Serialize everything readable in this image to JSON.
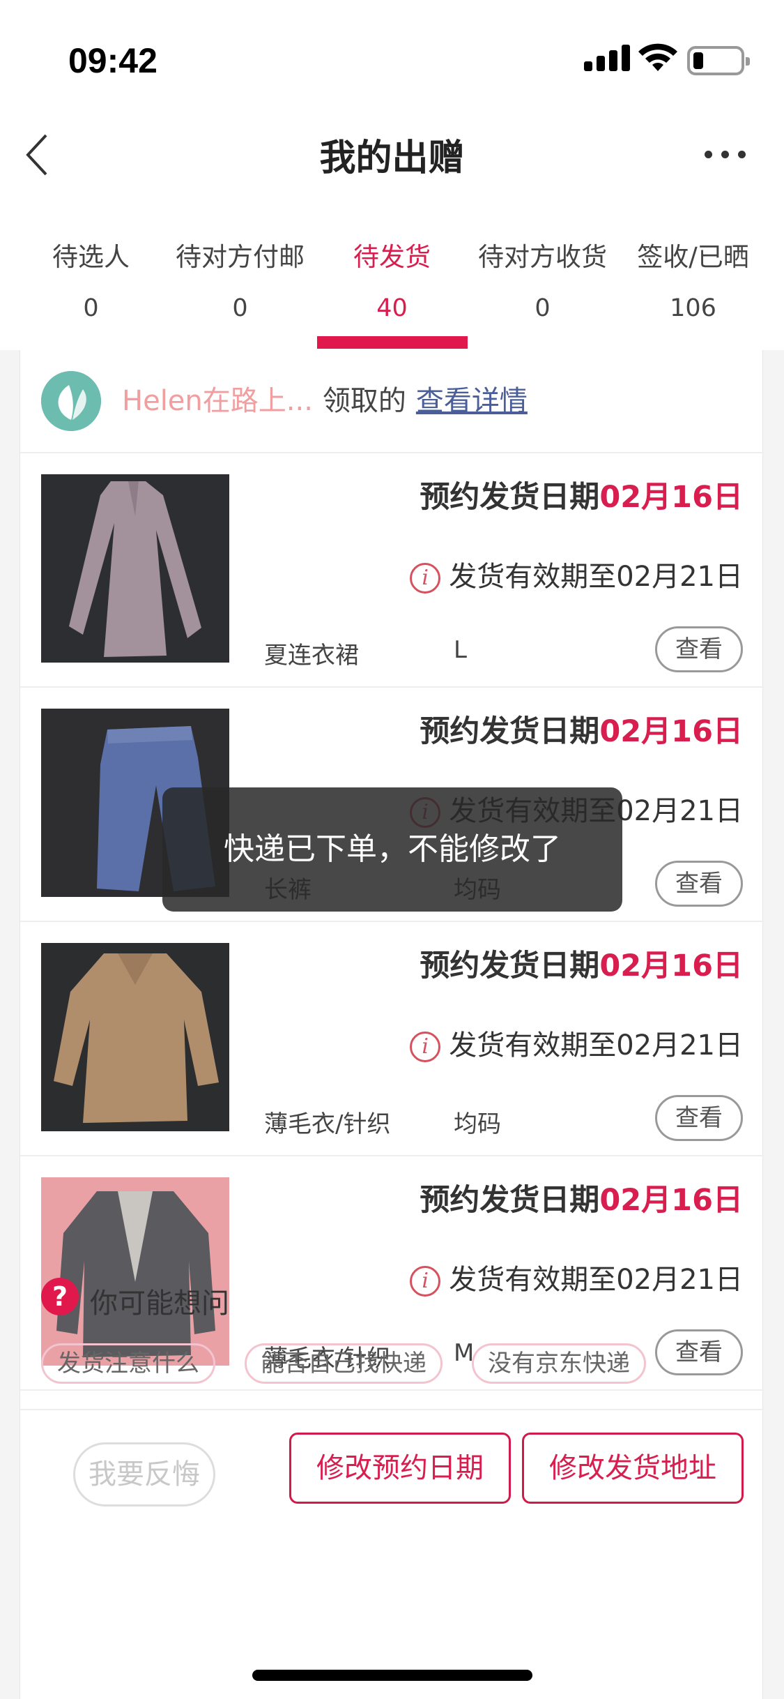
{
  "status_bar": {
    "time": "09:42"
  },
  "nav": {
    "title": "我的出赠"
  },
  "tabs": [
    {
      "label": "待选人",
      "count": "0"
    },
    {
      "label": "待对方付邮",
      "count": "0"
    },
    {
      "label": "待发货",
      "count": "40",
      "active": true
    },
    {
      "label": "待对方收货",
      "count": "0"
    },
    {
      "label": "签收/已晒",
      "count": "106"
    }
  ],
  "receiver": {
    "name": "Helen在路上...",
    "suffix": "领取的",
    "details_link": "查看详情"
  },
  "items": [
    {
      "ship_label": "预约发货日期",
      "ship_date": "02月16日",
      "validity": "发货有效期至02月21日",
      "category": "夏连衣裙",
      "size": "L",
      "view_label": "查看"
    },
    {
      "ship_label": "预约发货日期",
      "ship_date": "02月16日",
      "validity": "发货有效期至02月21日",
      "category": "长裤",
      "size": "均码",
      "view_label": "查看"
    },
    {
      "ship_label": "预约发货日期",
      "ship_date": "02月16日",
      "validity": "发货有效期至02月21日",
      "category": "薄毛衣/针织",
      "size": "均码",
      "view_label": "查看"
    },
    {
      "ship_label": "预约发货日期",
      "ship_date": "02月16日",
      "validity": "发货有效期至02月21日",
      "category": "薄毛衣/针织",
      "size": "M",
      "view_label": "查看"
    }
  ],
  "faq": {
    "title": "你可能想问",
    "chips": [
      "发货注意什么",
      "能否自己找快递",
      "没有京东快递"
    ]
  },
  "actions": {
    "regret": "我要反悔",
    "change_date": "修改预约日期",
    "change_address": "修改发货地址"
  },
  "toast": "快递已下单，不能修改了",
  "colors": {
    "accent": "#e0184c",
    "link": "#4a5f9a"
  }
}
